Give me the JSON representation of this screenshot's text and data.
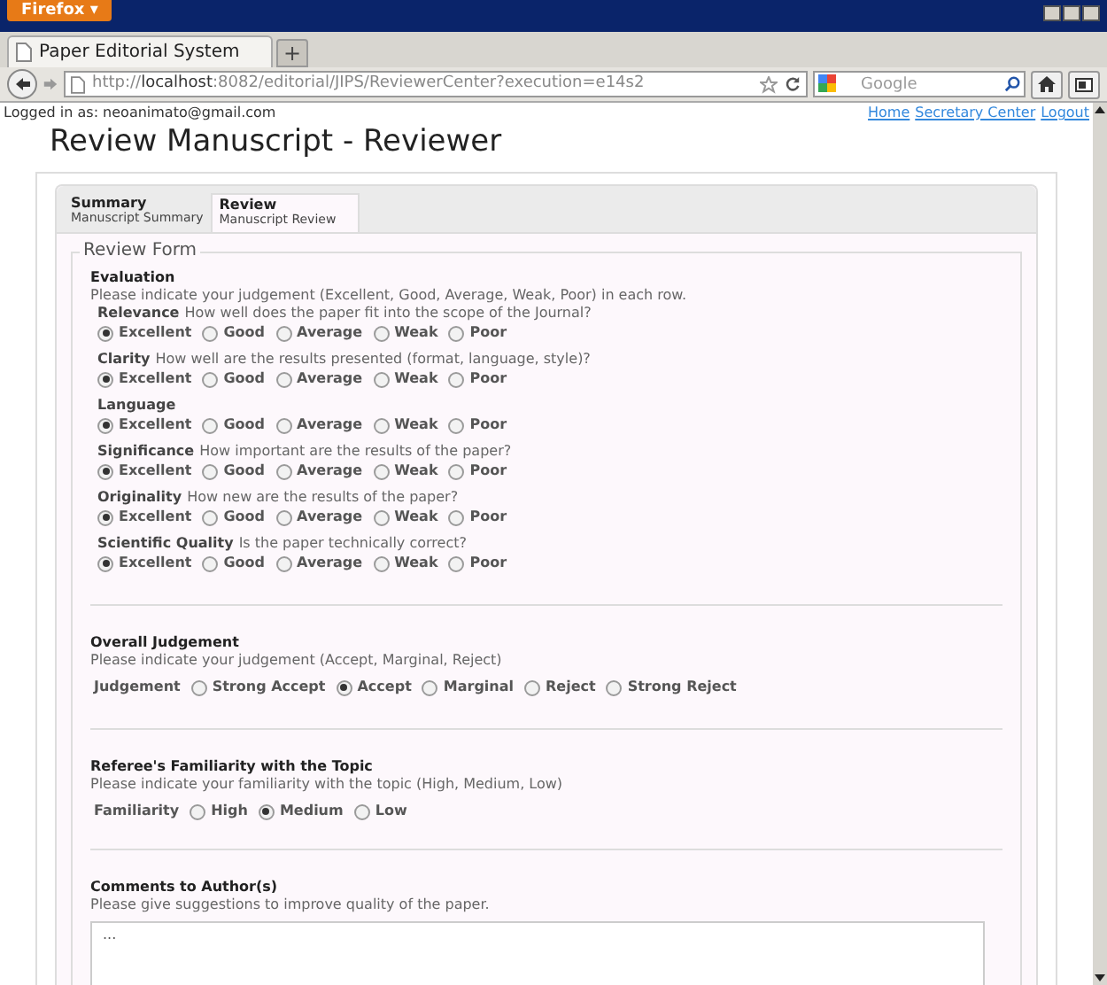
{
  "browser": {
    "menu_button": "Firefox ▾",
    "tab_title": "Paper Editorial System",
    "new_tab": "+",
    "url_prefix": "http://",
    "url_host": "localhost",
    "url_rest": ":8082/editorial/JIPS/ReviewerCenter?execution=e14s2",
    "search_placeholder": "Google"
  },
  "header": {
    "logged_in": "Logged in as: neoanimato@gmail.com",
    "links": [
      "Home",
      "Secretary Center",
      "Logout"
    ],
    "title": "Review Manuscript - Reviewer"
  },
  "tabs": [
    {
      "title": "Summary",
      "subtitle": "Manuscript Summary",
      "selected": false
    },
    {
      "title": "Review",
      "subtitle": "Manuscript Review",
      "selected": true
    }
  ],
  "form": {
    "legend": "Review Form",
    "evaluation": {
      "title": "Evaluation",
      "hint": "Please indicate your judgement (Excellent, Good, Average, Weak, Poor) in each row.",
      "criteria": [
        {
          "label": "Relevance",
          "question": "How well does the paper fit into the scope of the Journal?",
          "options": [
            {
              "label": "Excellent",
              "selected": true
            },
            {
              "label": "Good",
              "selected": false
            },
            {
              "label": "Average",
              "selected": false
            },
            {
              "label": "Weak",
              "selected": false
            },
            {
              "label": "Poor",
              "selected": false
            }
          ]
        },
        {
          "label": "Clarity",
          "question": "How well are the results presented (format, language, style)?",
          "options": [
            {
              "label": "Excellent",
              "selected": true
            },
            {
              "label": "Good",
              "selected": false
            },
            {
              "label": "Average",
              "selected": false
            },
            {
              "label": "Weak",
              "selected": false
            },
            {
              "label": "Poor",
              "selected": false
            }
          ]
        },
        {
          "label": "Language",
          "options": [
            {
              "label": "Excellent",
              "selected": true
            },
            {
              "label": "Good",
              "selected": false
            },
            {
              "label": "Average",
              "selected": false
            },
            {
              "label": "Weak",
              "selected": false
            },
            {
              "label": "Poor",
              "selected": false
            }
          ]
        },
        {
          "label": "Significance",
          "question": "How important are the results of the paper?",
          "options": [
            {
              "label": "Excellent",
              "selected": true
            },
            {
              "label": "Good",
              "selected": false
            },
            {
              "label": "Average",
              "selected": false
            },
            {
              "label": "Weak",
              "selected": false
            },
            {
              "label": "Poor",
              "selected": false
            }
          ]
        },
        {
          "label": "Originality",
          "question": "How new are the results of the paper?",
          "options": [
            {
              "label": "Excellent",
              "selected": true
            },
            {
              "label": "Good",
              "selected": false
            },
            {
              "label": "Average",
              "selected": false
            },
            {
              "label": "Weak",
              "selected": false
            },
            {
              "label": "Poor",
              "selected": false
            }
          ]
        },
        {
          "label": "Scientific Quality",
          "question": "Is the paper technically correct?",
          "options": [
            {
              "label": "Excellent",
              "selected": true
            },
            {
              "label": "Good",
              "selected": false
            },
            {
              "label": "Average",
              "selected": false
            },
            {
              "label": "Weak",
              "selected": false
            },
            {
              "label": "Poor",
              "selected": false
            }
          ]
        }
      ]
    },
    "groups": [
      {
        "title": "Overall Judgement",
        "hint": "Please indicate your judgement (Accept, Marginal, Reject)",
        "label": "Judgement",
        "options": [
          {
            "label": "Strong Accept",
            "selected": false
          },
          {
            "label": "Accept",
            "selected": true
          },
          {
            "label": "Marginal",
            "selected": false
          },
          {
            "label": "Reject",
            "selected": false
          },
          {
            "label": "Strong Reject",
            "selected": false
          }
        ]
      },
      {
        "title": "Referee's Familiarity with the Topic",
        "hint": "Please indicate your familiarity with the topic (High, Medium, Low)",
        "label": "Familiarity",
        "options": [
          {
            "label": "High",
            "selected": false
          },
          {
            "label": "Medium",
            "selected": true
          },
          {
            "label": "Low",
            "selected": false
          }
        ]
      }
    ],
    "comments": {
      "title": "Comments to Author(s)",
      "hint": "Please give suggestions to improve quality of the paper.",
      "value": "..."
    }
  }
}
